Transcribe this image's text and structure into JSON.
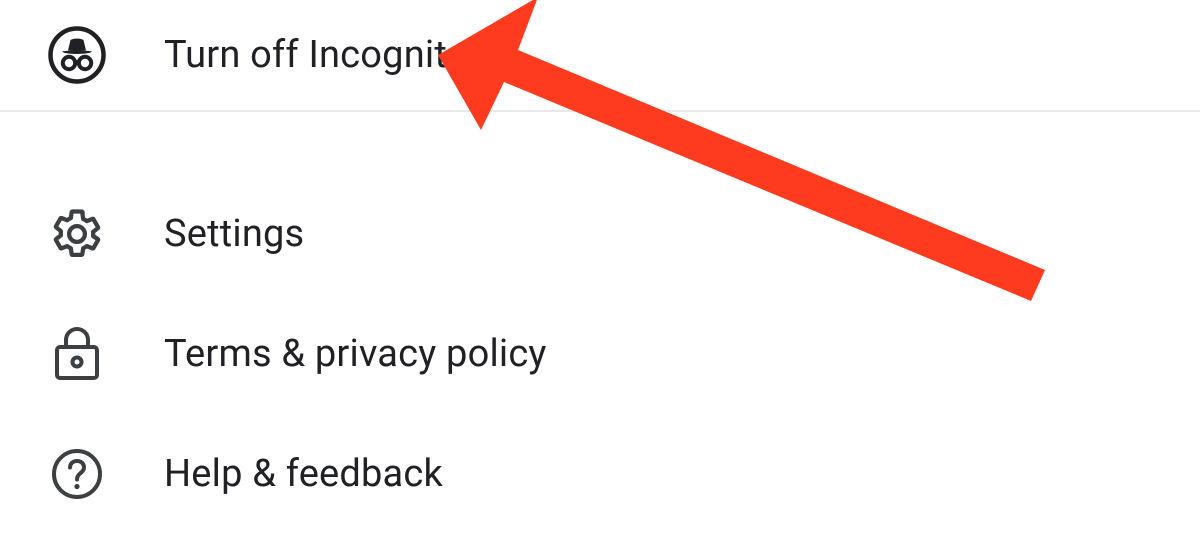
{
  "menu": {
    "items": [
      {
        "label": "Turn off Incognito"
      },
      {
        "label": "Settings"
      },
      {
        "label": "Terms & privacy policy"
      },
      {
        "label": "Help & feedback"
      }
    ]
  },
  "annotation": {
    "color": "#ff3b1f"
  }
}
